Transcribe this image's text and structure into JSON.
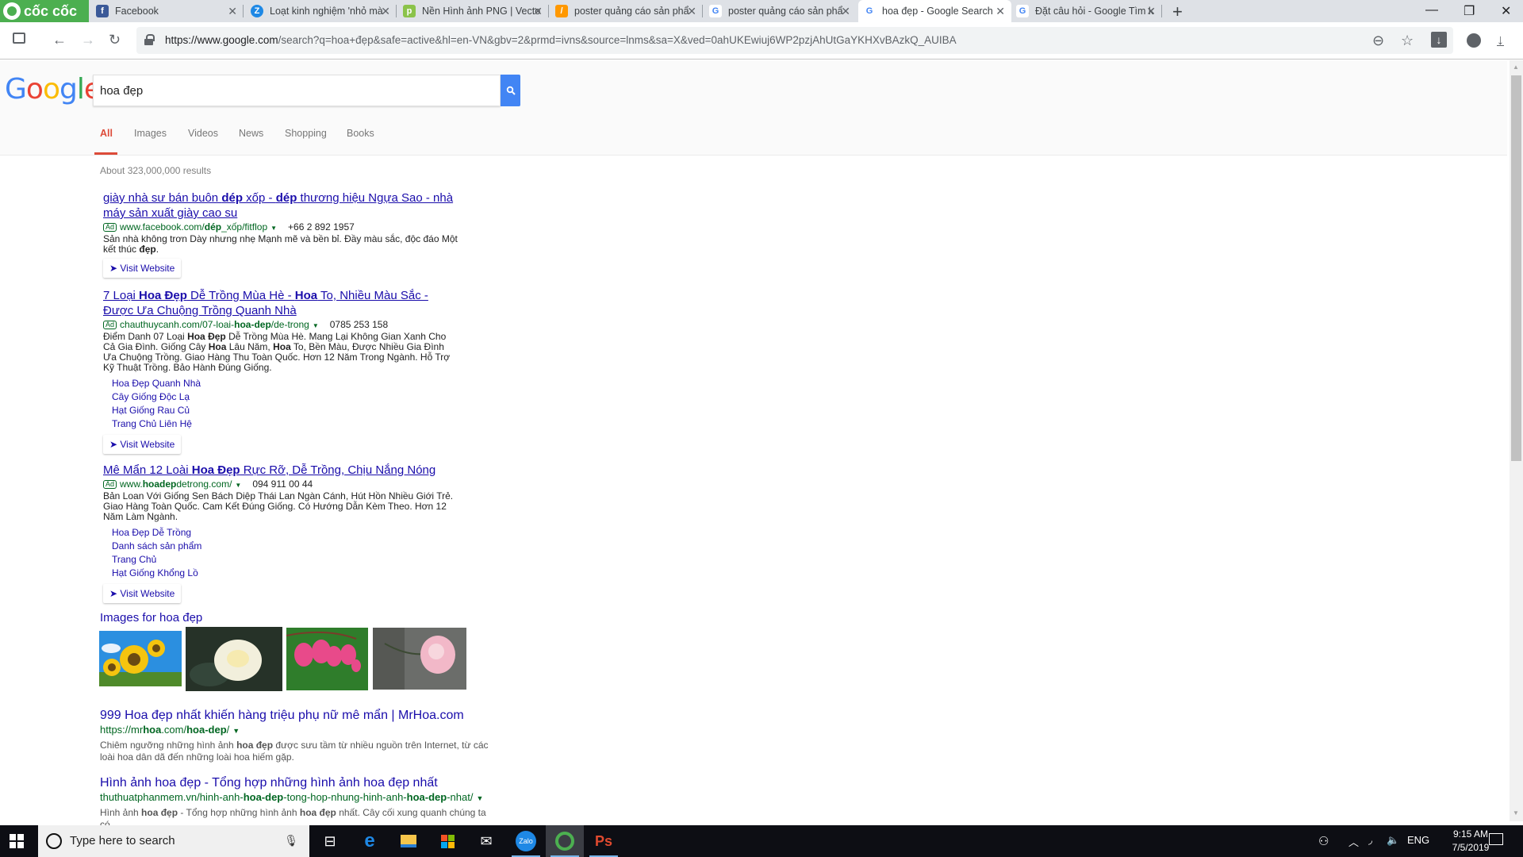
{
  "browser": {
    "brand": "cốc cốc",
    "tabs": [
      {
        "title": "Facebook",
        "favicon": "facebook-icon",
        "color": "#3b5998",
        "glyph": "f"
      },
      {
        "title": "Loạt kinh nghiệm 'nhỏ mà",
        "favicon": "zing-icon",
        "color": "#1e88e5",
        "glyph": "Z"
      },
      {
        "title": "Nền Hình ảnh PNG | Vecto",
        "favicon": "pngtree-icon",
        "color": "#8bc34a",
        "glyph": "p"
      },
      {
        "title": "poster quảng cáo sản phẩ",
        "favicon": "brush-icon",
        "color": "#ff9800",
        "glyph": "/"
      },
      {
        "title": "poster quảng cáo sản phẩ",
        "favicon": "google-icon",
        "color": "#4285f4",
        "glyph": "G"
      },
      {
        "title": "hoa đẹp - Google Search",
        "favicon": "google-icon",
        "color": "#4285f4",
        "glyph": "G",
        "active": true
      },
      {
        "title": "Đặt câu hỏi - Google Tìm k",
        "favicon": "google-icon",
        "color": "#4285f4",
        "glyph": "G"
      }
    ],
    "url_host": "https://www.google.com",
    "url_path": "/search?q=hoa+đẹp&safe=active&hl=en-VN&gbv=2&prmd=ivns&source=lnms&sa=X&ved=0ahUKEwiuj6WP2pzjAhUtGaYKHXvBAzkQ_AUIBA"
  },
  "google": {
    "query": "hoa đẹp",
    "tabs": [
      "All",
      "Images",
      "Videos",
      "News",
      "Shopping",
      "Books"
    ],
    "stats": "About 323,000,000 results",
    "visit_label": "Visit Website",
    "ad_badge": "Ad",
    "ads": [
      {
        "title_parts": [
          "giày nhà sư bán buôn ",
          "dép",
          " xốp - ",
          "dép",
          " thương hiệu Ngựa Sao - nhà máy sản xuất giày cao su"
        ],
        "url_parts": [
          "www.facebook.com/",
          "dép",
          "_xốp/fitflop"
        ],
        "phone": "+66 2 892 1957",
        "desc_parts": [
          "Sản nhà không trơn Dày nhưng nhẹ Mạnh mẽ và bền bỉ. Đầy màu sắc, độc đáo Một kết thúc ",
          "đẹp",
          "."
        ],
        "sitelinks": []
      },
      {
        "title_parts": [
          "7 Loại ",
          "Hoa Đẹp",
          " Dễ Trồng Mùa Hè - ",
          "Hoa",
          " To, Nhiều Màu Sắc - Được Ưa Chuộng Trồng Quanh Nhà"
        ],
        "url_parts": [
          "chauthuycanh.com/07-loai-",
          "hoa-dep",
          "/de-trong"
        ],
        "phone": "0785 253 158",
        "desc_parts": [
          "Điểm Danh 07 Loại ",
          "Hoa Đẹp",
          " Dễ Trồng Mùa Hè. Mang Lại Không Gian Xanh Cho Cả Gia Đình. Giống Cây ",
          "Hoa",
          " Lâu Năm, ",
          "Hoa",
          " To, Bền Màu, Được Nhiều Gia Đình Ưa Chuộng Trồng. Giao Hàng Thu Toàn Quốc. Hơn 12 Năm Trong Ngành. Hỗ Trợ Kỹ Thuật Trồng. Bảo Hành Đúng Giống."
        ],
        "sitelinks": [
          "Hoa Đẹp Quanh Nhà",
          "Cây Giống Độc Lạ",
          "Hạt Giống Rau Củ",
          "Trang Chủ Liên Hệ"
        ]
      },
      {
        "title_parts": [
          "Mê Mẩn 12 Loài ",
          "Hoa Đẹp",
          " Rực Rỡ, Dễ Trồng, Chịu Nắng Nóng"
        ],
        "url_parts": [
          "www.",
          "hoadep",
          "detrong.com/"
        ],
        "phone": "094 911 00 44",
        "desc_parts": [
          "Bản Loan Với Giống Sen Bách Diệp Thái Lan Ngàn Cánh, Hút Hồn Nhiều Giới Trẻ. Giao Hàng Toàn Quốc. Cam Kết Đúng Giống. Có Hướng Dẫn Kèm Theo. Hơn 12 Năm Làm Ngành."
        ],
        "sitelinks": [
          "Hoa Đẹp Dễ Trồng",
          "Danh sách sản phẩm",
          "Trang Chủ",
          "Hạt Giống Khổng Lồ"
        ]
      }
    ],
    "images_heading": "Images for hoa đẹp",
    "images": [
      {
        "name": "sunflower-thumbnail",
        "subject": "sunflowers"
      },
      {
        "name": "white-rose-thumbnail",
        "subject": "white rose"
      },
      {
        "name": "bleeding-heart-thumbnail",
        "subject": "bleeding heart flowers"
      },
      {
        "name": "pink-rose-thumbnail",
        "subject": "pink rose"
      }
    ],
    "organic": [
      {
        "title": "999 Hoa đẹp nhất khiến hàng triệu phụ nữ mê mẩn | MrHoa.com",
        "url_parts": [
          "https://mr",
          "hoa",
          ".com/",
          "hoa-dep",
          "/"
        ],
        "desc_parts": [
          "Chiêm ngưỡng những hình ảnh ",
          "hoa đẹp",
          " được sưu tầm từ nhiều nguồn trên Internet, từ các loài hoa dân dã đến những loài hoa hiếm gặp."
        ]
      },
      {
        "title": "Hình ảnh hoa đẹp - Tổng hợp những hình ảnh hoa đẹp nhất",
        "url_parts": [
          "thuthuatphanmem.vn/hinh-anh-",
          "hoa-dep",
          "-tong-hop-nhung-hinh-anh-",
          "hoa-dep",
          "-nhat/"
        ],
        "desc_parts": [
          "Hình ảnh ",
          "hoa đẹp",
          " - Tổng hợp những hình ảnh ",
          "hoa đẹp",
          " nhất. Cây cối xung quanh chúng ta có"
        ]
      }
    ]
  },
  "taskbar": {
    "search_placeholder": "Type here to search",
    "apps": [
      "task-view-icon",
      "edge-icon",
      "file-explorer-icon",
      "store-icon",
      "mail-icon",
      "zalo-icon",
      "coccoc-icon",
      "powerpoint-icon"
    ],
    "language": "ENG",
    "time": "9:15 AM",
    "date": "7/5/2019"
  }
}
